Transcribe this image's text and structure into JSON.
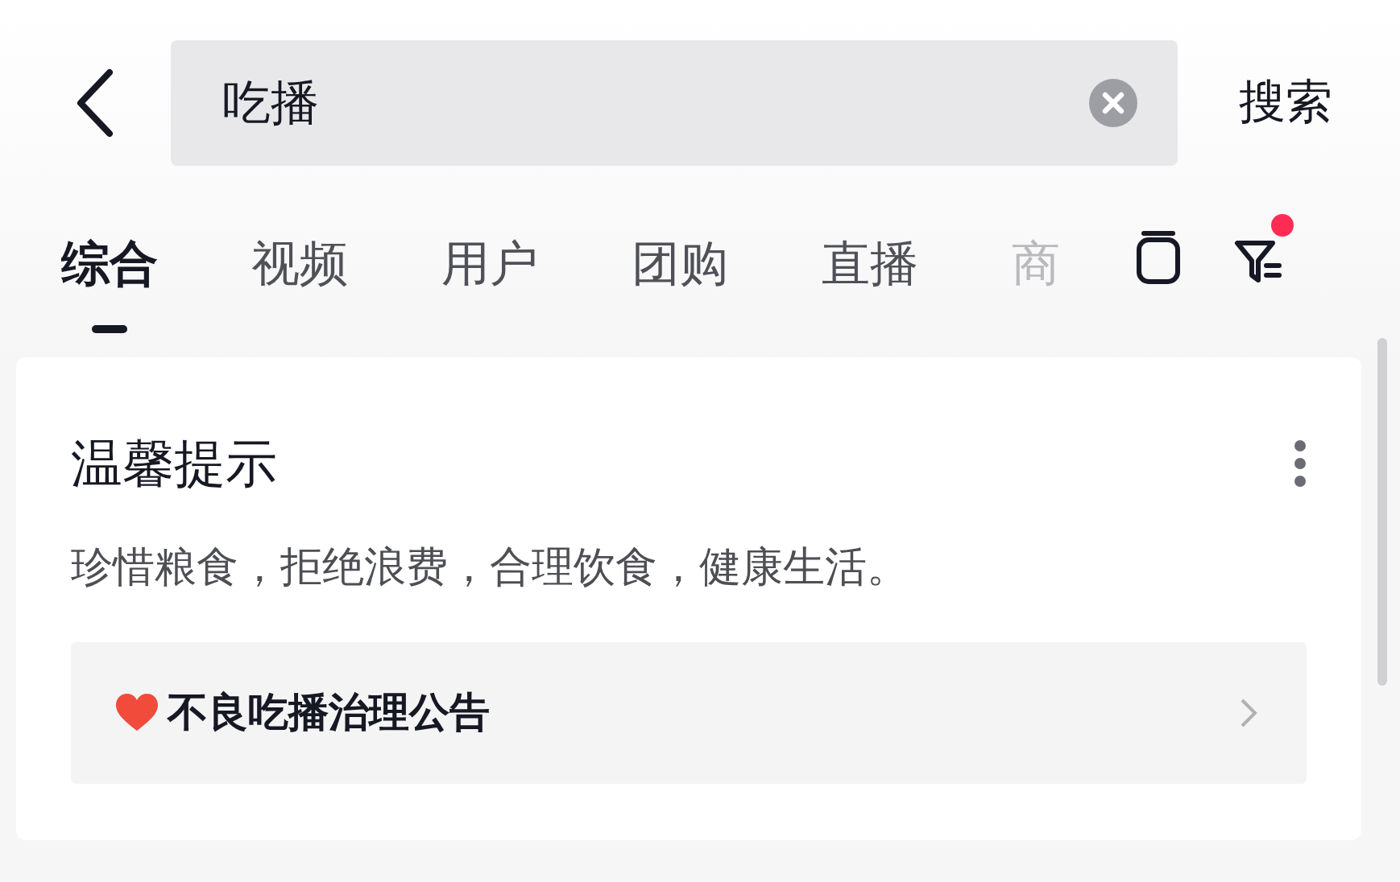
{
  "search": {
    "value": "吃播",
    "action": "搜索"
  },
  "tabs": [
    {
      "label": "综合",
      "selected": true
    },
    {
      "label": "视频",
      "selected": false
    },
    {
      "label": "用户",
      "selected": false
    },
    {
      "label": "团购",
      "selected": false
    },
    {
      "label": "直播",
      "selected": false
    },
    {
      "label": "商",
      "selected": false
    }
  ],
  "filter": {
    "has_notification": true
  },
  "card": {
    "title": "温馨提示",
    "text": "珍惜粮食，拒绝浪费，合理饮食，健康生活。",
    "link": "不良吃播治理公告"
  }
}
